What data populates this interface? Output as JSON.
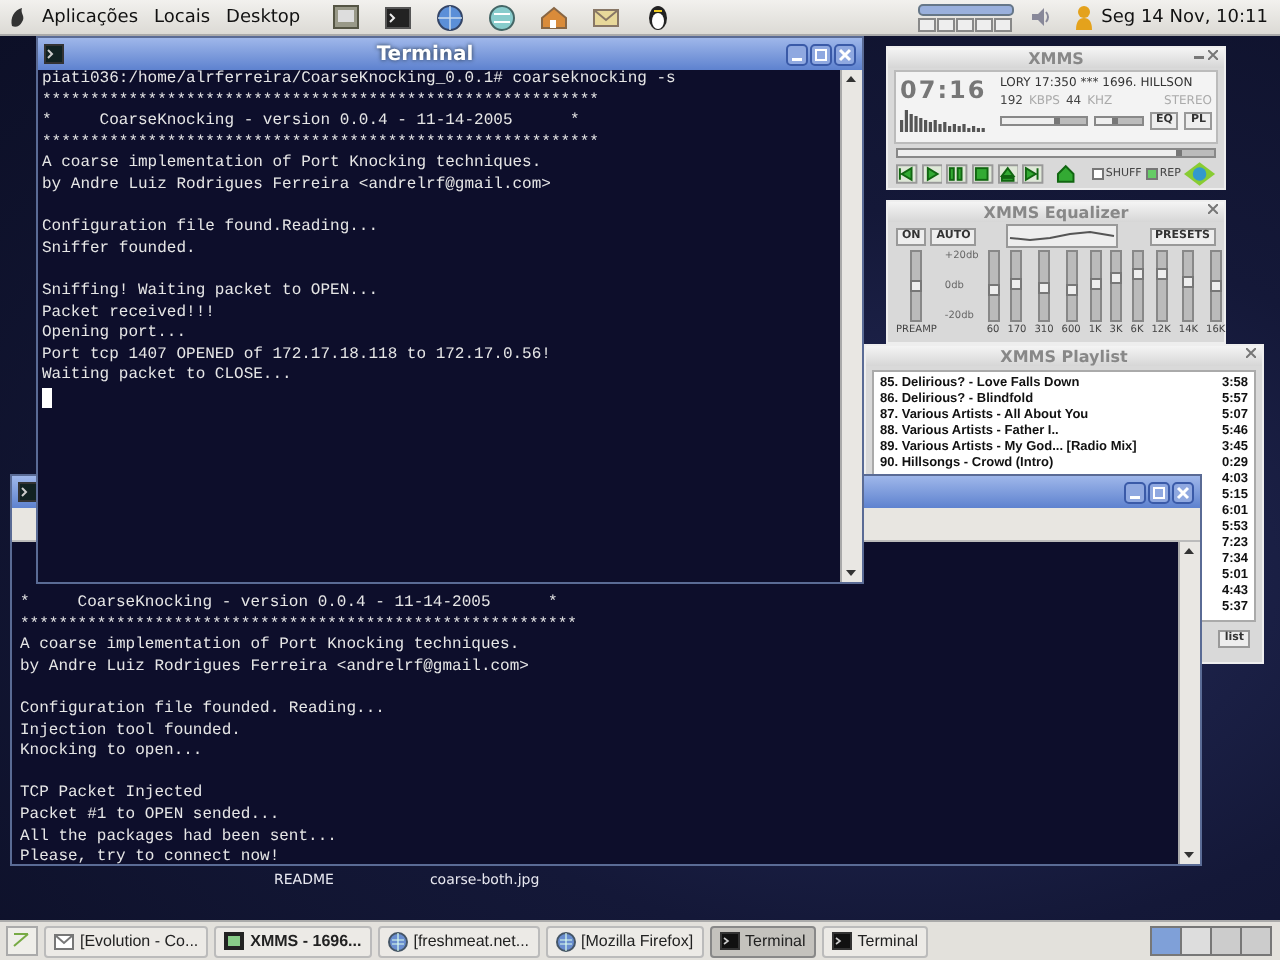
{
  "top_panel": {
    "menus": [
      "Aplicações",
      "Locais",
      "Desktop"
    ],
    "clock": "Seg 14 Nov, 10:11"
  },
  "terminal_front": {
    "title": "Terminal",
    "blocks": [
      [
        "piati036:/home/alrferreira/CoarseKnocking_0.0.1# coarseknocking -s",
        "**********************************************************",
        "*     CoarseKnocking - version 0.0.4 - 11-14-2005      *",
        "**********************************************************",
        "A coarse implementation of Port Knocking techniques.",
        "by Andre Luiz Rodrigues Ferreira <andrelrf@gmail.com>"
      ],
      [
        "Configuration file found.Reading...",
        "Sniffer founded."
      ],
      [
        "Sniffing! Waiting packet to OPEN...",
        "Packet received!!!",
        "Opening port...",
        "Port tcp 1407 OPENED of 172.17.18.118 to 172.17.0.56!",
        "Waiting packet to CLOSE..."
      ]
    ]
  },
  "terminal_back": {
    "blocks": [
      [
        "*     CoarseKnocking - version 0.0.4 - 11-14-2005      *",
        "**********************************************************",
        "A coarse implementation of Port Knocking techniques.",
        "by Andre Luiz Rodrigues Ferreira <andrelrf@gmail.com>"
      ],
      [
        "Configuration file founded. Reading...",
        "Injection tool founded.",
        "Knocking to open..."
      ],
      [
        "TCP Packet Injected",
        "Packet #1 to OPEN sended...",
        "All the packages had been sent...",
        "Please, try to connect now!"
      ]
    ]
  },
  "xmms": {
    "title": "XMMS",
    "time": "07:16",
    "song": "LORY 17:350  ***  1696. HILLSON",
    "bitrate": "192",
    "bitrate_unit": "KBPS",
    "samplerate": "44",
    "samplerate_unit": "KHZ",
    "mode": "STEREO",
    "volume": {
      "level": 0.7
    },
    "balance": {
      "level": 0.5
    },
    "eq_button": "EQ",
    "pl_button": "PL",
    "position": {
      "level": 0.9
    },
    "shuffle": {
      "label": "SHUFF",
      "checked": false
    },
    "repeat": {
      "label": "REP",
      "checked": true
    }
  },
  "equalizer": {
    "title": "XMMS Equalizer",
    "on_button": "ON",
    "auto_button": "AUTO",
    "preset_button": "PRESETS",
    "db_labels": [
      "+20db",
      "0db",
      "-20db"
    ],
    "preamp": {
      "label": "PREAMP",
      "level": 0.5
    },
    "bands": [
      {
        "label": "60",
        "level": 0.42
      },
      {
        "label": "170",
        "level": 0.52
      },
      {
        "label": "310",
        "level": 0.46
      },
      {
        "label": "600",
        "level": 0.43
      },
      {
        "label": "1K",
        "level": 0.52
      },
      {
        "label": "3K",
        "level": 0.65
      },
      {
        "label": "6K",
        "level": 0.7
      },
      {
        "label": "12K",
        "level": 0.71
      },
      {
        "label": "14K",
        "level": 0.58
      },
      {
        "label": "16K",
        "level": 0.5
      }
    ]
  },
  "playlist": {
    "title": "XMMS Playlist",
    "rows": [
      {
        "title": "85. Delirious? - Love Falls Down",
        "time": "3:58"
      },
      {
        "title": "86. Delirious? - Blindfold",
        "time": "5:57"
      },
      {
        "title": "87. Various Artists - All About You",
        "time": "5:07"
      },
      {
        "title": "88. Various Artists - Father I..",
        "time": "5:46"
      },
      {
        "title": "89. Various Artists - My God... [Radio Mix]",
        "time": "3:45"
      },
      {
        "title": "90. Hillsongs - Crowd (Intro)",
        "time": "0:29"
      },
      {
        "time": "4:03"
      },
      {
        "time": "5:15"
      },
      {
        "time": "6:01"
      },
      {
        "time": "5:53"
      },
      {
        "time": "7:23"
      },
      {
        "time": "7:34"
      },
      {
        "time": "5:01"
      },
      {
        "time": "4:43"
      },
      {
        "time": "5:37"
      }
    ],
    "list_button": "list"
  },
  "desktop_icons": [
    {
      "label": "README"
    },
    {
      "label": "coarse-both.jpg"
    }
  ],
  "taskbar": {
    "items": [
      {
        "label": "[Evolution - Co...",
        "kind": "mail",
        "selected": false,
        "urgent": false
      },
      {
        "label": "XMMS - 1696...",
        "kind": "player",
        "selected": false,
        "urgent": true
      },
      {
        "label": "[freshmeat.net...",
        "kind": "browser",
        "selected": false,
        "urgent": false
      },
      {
        "label": "[Mozilla Firefox]",
        "kind": "browser",
        "selected": false,
        "urgent": false
      },
      {
        "label": "Terminal",
        "kind": "terminal",
        "selected": true,
        "urgent": false
      },
      {
        "label": "Terminal",
        "kind": "terminal",
        "selected": false,
        "urgent": false
      }
    ]
  }
}
